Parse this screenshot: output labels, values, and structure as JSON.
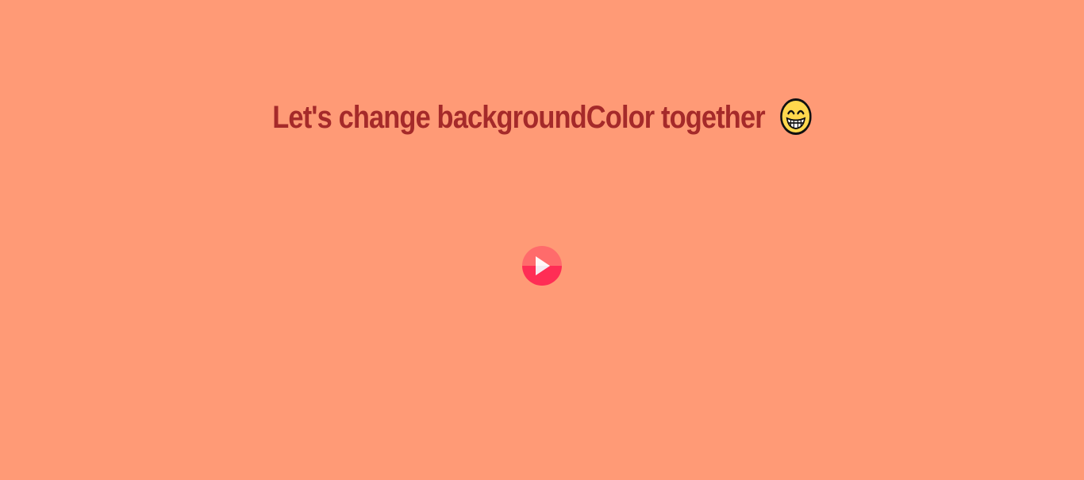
{
  "page": {
    "background_color": "#ff9a76",
    "heading_color": "#a52a2a",
    "heading": "Let's change backgroundColor together",
    "heading_emoji": "grinning-face-icon"
  },
  "play_button": {
    "icon": "play-icon",
    "color_top": "#ff6b6b",
    "color_bottom": "#ff2d55"
  }
}
